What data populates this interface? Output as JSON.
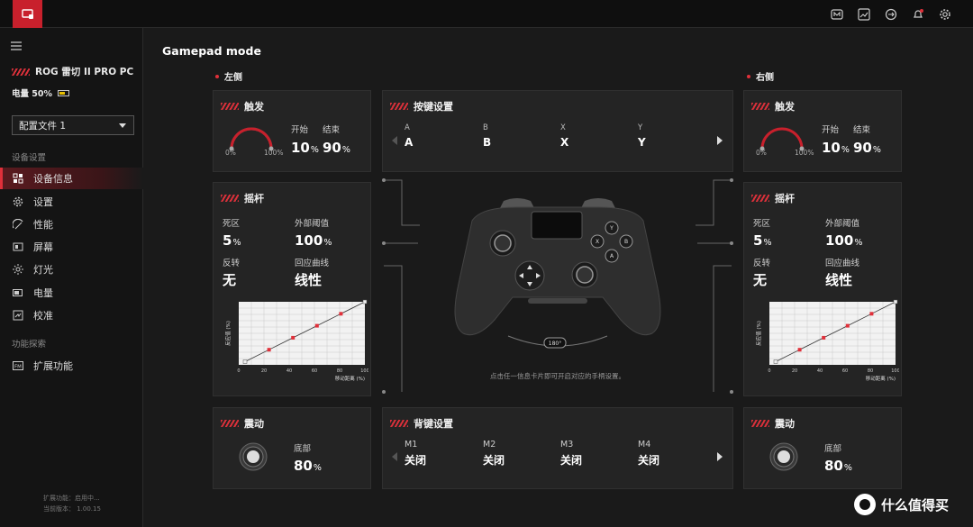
{
  "topbar": {
    "icons": [
      "device-icon",
      "m-icon",
      "image-icon",
      "sync-icon",
      "bell-icon",
      "gear-icon"
    ]
  },
  "sidebar": {
    "device_name": "ROG 雷切 II PRO PC",
    "battery_label": "电量 50%",
    "profile_value": "配置文件 1",
    "section_settings": "设备设置",
    "items": [
      {
        "label": "设备信息",
        "icon": "device-info-icon"
      },
      {
        "label": "设置",
        "icon": "gear-icon"
      },
      {
        "label": "性能",
        "icon": "performance-icon"
      },
      {
        "label": "屏幕",
        "icon": "screen-icon"
      },
      {
        "label": "灯光",
        "icon": "light-icon"
      },
      {
        "label": "电量",
        "icon": "battery-icon"
      },
      {
        "label": "校准",
        "icon": "calibrate-icon"
      }
    ],
    "section_explore": "功能探索",
    "explore_item": "扩展功能",
    "footer_line1": "扩展功能：启用中...",
    "footer_line2": "当前版本： 1.00.15"
  },
  "main": {
    "title": "Gamepad mode",
    "left_label": "左侧",
    "right_label": "右侧",
    "hint": "点击任一信息卡片即可开启对应的手柄设置。",
    "rotate_badge": "180°"
  },
  "trigger": {
    "title": "触发",
    "start_label": "开始",
    "end_label": "结束",
    "range_min": "0%",
    "range_max": "100%",
    "left": {
      "start": "10",
      "end": "90"
    },
    "right": {
      "start": "10",
      "end": "90"
    },
    "unit": "%"
  },
  "keys": {
    "title": "按键设置",
    "items": [
      {
        "name": "A",
        "value": "A"
      },
      {
        "name": "B",
        "value": "B"
      },
      {
        "name": "X",
        "value": "X"
      },
      {
        "name": "Y",
        "value": "Y"
      }
    ]
  },
  "stick": {
    "title": "摇杆",
    "deadzone_label": "死区",
    "outer_label": "外部阈值",
    "invert_label": "反转",
    "curve_label": "回应曲线",
    "deadzone": "5",
    "outer": "100",
    "invert": "无",
    "curve": "线性",
    "unit": "%"
  },
  "chart_data": {
    "type": "line",
    "x": [
      5,
      24,
      43,
      62,
      81,
      100
    ],
    "y": [
      5,
      24,
      43,
      62,
      81,
      100
    ],
    "xlim": [
      0,
      100
    ],
    "ylim": [
      0,
      100
    ],
    "xticks": [
      "0",
      "20",
      "40",
      "60",
      "80",
      "100"
    ],
    "xlabel": "移动距离 (%)",
    "ylabel": "反应值 (%)",
    "grid": true,
    "accent": "#e0303a"
  },
  "vibration": {
    "title": "震动",
    "label": "底部",
    "left_value": "80",
    "right_value": "80",
    "unit": "%"
  },
  "back_keys": {
    "title": "背键设置",
    "items": [
      {
        "name": "M1",
        "value": "关闭"
      },
      {
        "name": "M2",
        "value": "关闭"
      },
      {
        "name": "M3",
        "value": "关闭"
      },
      {
        "name": "M4",
        "value": "关闭"
      }
    ]
  },
  "watermark": "什么值得买",
  "colors": {
    "accent": "#d9303a",
    "bg": "#1a1a1a",
    "card": "#242424"
  }
}
